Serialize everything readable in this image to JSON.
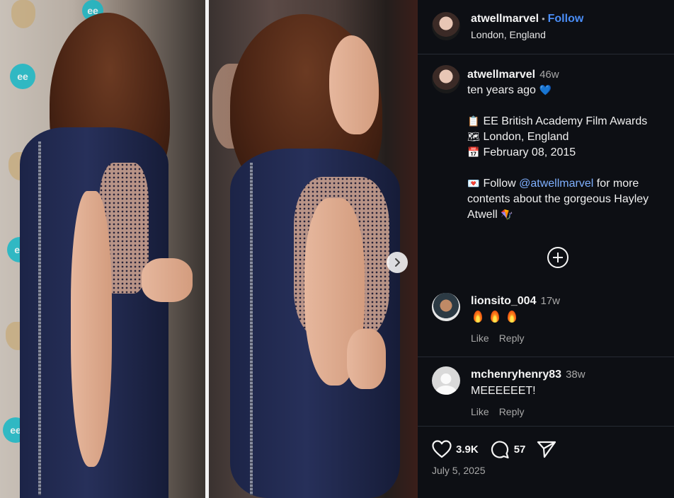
{
  "post": {
    "author": "atwellmarvel",
    "follow_label": "Follow",
    "separator": "•",
    "location": "London, England"
  },
  "caption": {
    "author": "atwellmarvel",
    "time": "46w",
    "line1": "ten years ago",
    "event": "EE British Academy Film Awards",
    "place": "London, England",
    "date": "February 08, 2015",
    "follow_prefix": "Follow ",
    "mention": "@atwellmarvel",
    "follow_suffix": " for more contents about the gorgeous Hayley Atwell",
    "emoji_heart": "💙",
    "emoji_clipboard": "📋",
    "emoji_map": "🗺",
    "emoji_calendar": "📅",
    "emoji_letter": "💌",
    "emoji_kite": "🪁"
  },
  "comments": [
    {
      "user": "lionsito_004",
      "time": "17w",
      "text": "",
      "like_label": "Like",
      "reply_label": "Reply"
    },
    {
      "user": "mchenryhenry83",
      "time": "38w",
      "text": "MEEEEEET!",
      "like_label": "Like",
      "reply_label": "Reply"
    }
  ],
  "stats": {
    "likes": "3.9K",
    "comments": "57",
    "posted": "July 5, 2025"
  },
  "icons": {
    "like": "heart-icon",
    "comment": "comment-icon",
    "share": "send-icon",
    "add": "plus-circle-icon",
    "next": "chevron-right-icon"
  },
  "colors": {
    "panel_bg": "#0d0f14",
    "link_blue": "#4a8df6",
    "muted": "#a8a8a8"
  }
}
